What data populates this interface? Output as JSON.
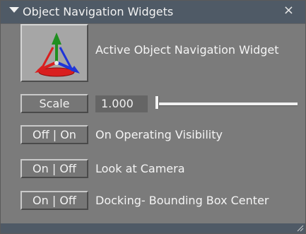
{
  "panel": {
    "title": "Object Navigation Widgets",
    "close_glyph": "×",
    "widget_label": "Active Object Navigation Widget",
    "icons": {
      "collapse": "triangle-down-icon",
      "close": "close-icon",
      "widget": "axis-gizmo-icon",
      "resize": "resize-grip-icon"
    }
  },
  "scale": {
    "button_label": "Scale",
    "value": "1.000",
    "slider_fraction": 0.0
  },
  "rows": [
    {
      "toggle_label": "Off | On",
      "label": "On Operating Visibility"
    },
    {
      "toggle_label": "On | Off",
      "label": "Look at Camera"
    },
    {
      "toggle_label": "On | Off",
      "label": "Docking- Bounding Box Center"
    }
  ],
  "colors": {
    "titlebar": "#4f5a66",
    "panel": "#7b7b7b",
    "axis_red": "#d91f1f",
    "axis_green": "#1f8f1f",
    "axis_blue": "#1f35d8"
  }
}
